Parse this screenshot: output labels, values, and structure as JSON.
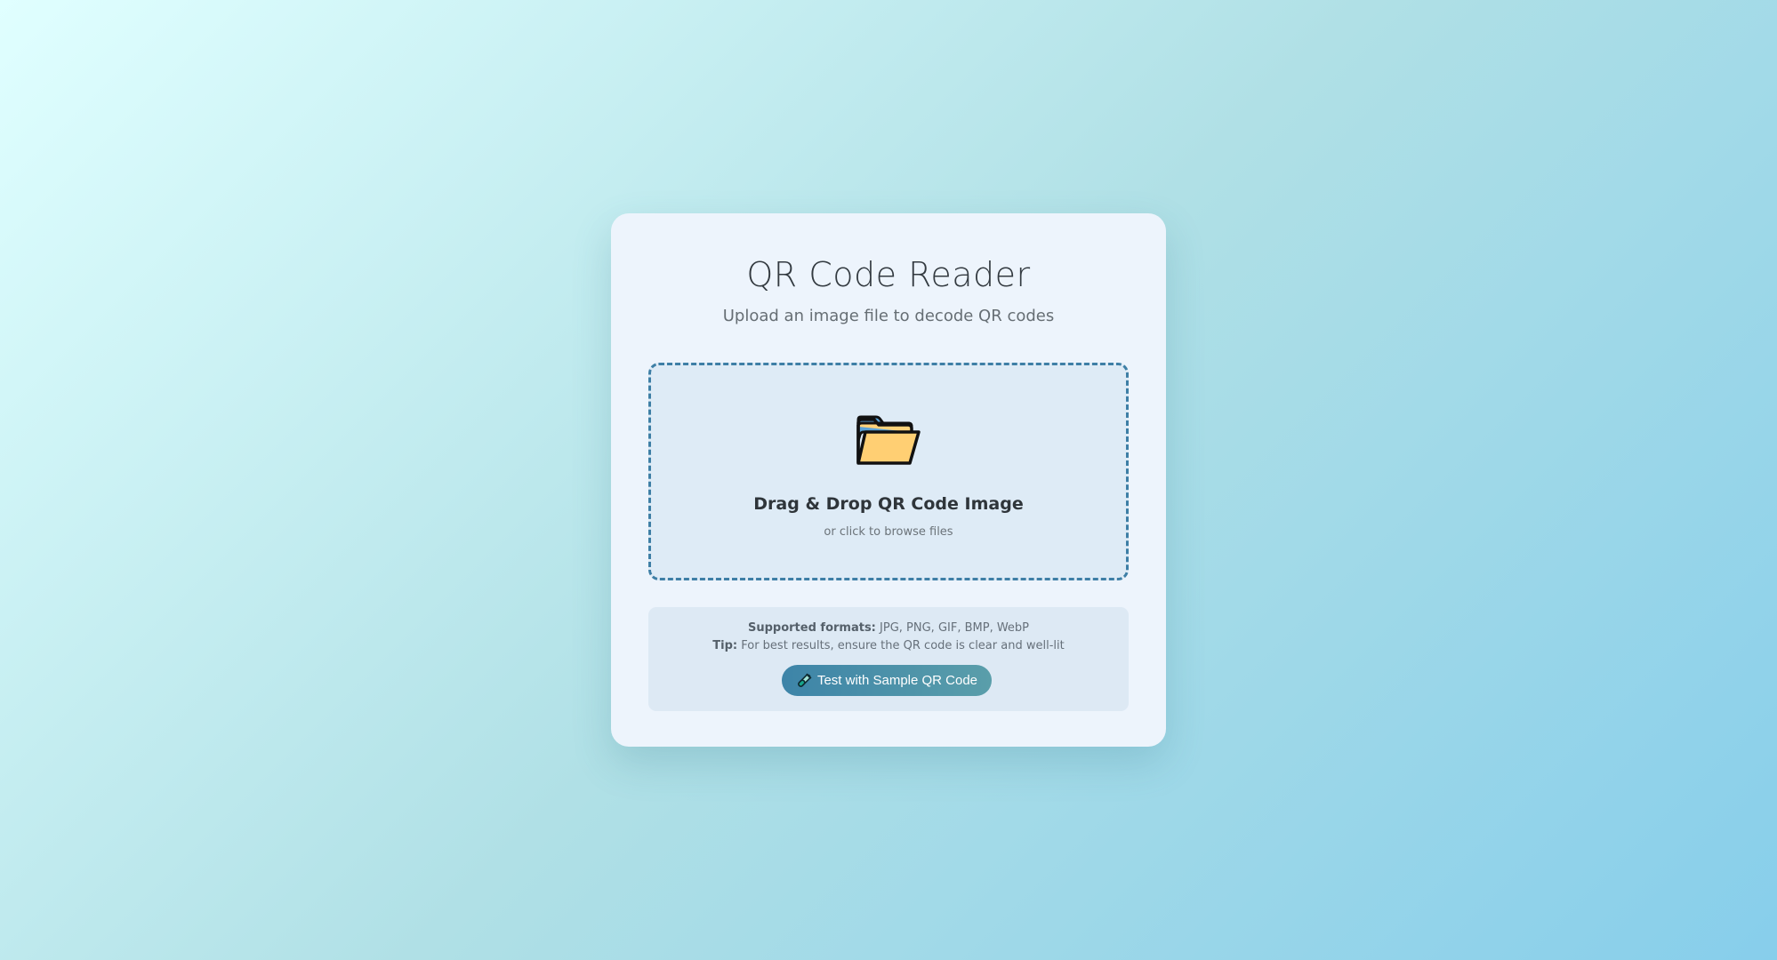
{
  "header": {
    "title": "QR Code Reader",
    "subtitle": "Upload an image file to decode QR codes"
  },
  "dropzone": {
    "icon": "folder-icon",
    "title": "Drag & Drop QR Code Image",
    "subtitle": "or click to browse files"
  },
  "info": {
    "formats_label": "Supported formats:",
    "formats_value": "JPG, PNG, GIF, BMP, WebP",
    "tip_label": "Tip:",
    "tip_value": "For best results, ensure the QR code is clear and well-lit"
  },
  "sample_button": {
    "icon": "test-tube-icon",
    "label": "Test with Sample QR Code"
  },
  "colors": {
    "accent": "#3d84a8",
    "dropzone_border": "#3e7fa6",
    "card_bg": "#edf4fc"
  }
}
